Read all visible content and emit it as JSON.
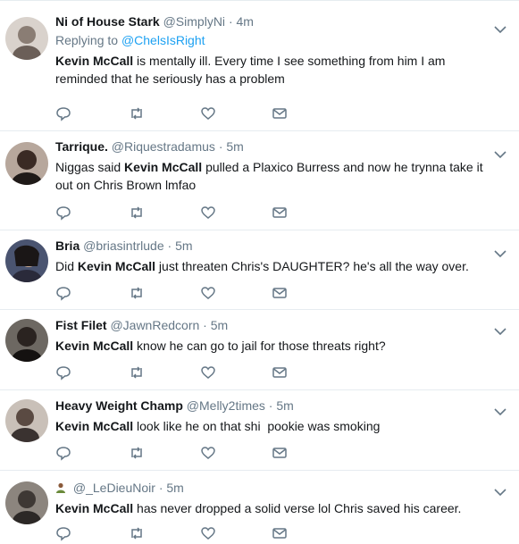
{
  "tweets": [
    {
      "name": "Ni of House Stark",
      "handle": "@SimplyNi",
      "time": "4m",
      "reply_prefix": "Replying to",
      "reply_handle": "@ChelsIsRight",
      "bold": "Kevin McCall",
      "text": " is mentally ill. Every time I see something from him I am reminded that he seriously has a problem",
      "avatar_color": "#8a7d74"
    },
    {
      "name": "Tarrique.",
      "handle": "@Riquestradamus",
      "time": "5m",
      "pre": "Niggas said ",
      "bold": "Kevin McCall",
      "text": " pulled a Plaxico Burress and now he trynna take it out on Chris Brown lmfao",
      "avatar_color": "#3a2a24"
    },
    {
      "name": "Bria",
      "handle": "@briasintrlude",
      "time": "5m",
      "pre": "Did ",
      "bold": "Kevin McCall",
      "text": " just threaten Chris's DAUGHTER? he's all the way over.",
      "avatar_color": "#5a6a8a"
    },
    {
      "name": "Fist Filet",
      "handle": "@JawnRedcorn",
      "time": "5m",
      "bold": "Kevin McCall",
      "text": " know he can go to jail for those threats right?",
      "avatar_color": "#2a2320"
    },
    {
      "name": "Heavy Weight Champ",
      "handle": "@Melly2times",
      "time": "5m",
      "bold": "Kevin McCall",
      "text": " look like he on that shi  pookie was smoking",
      "avatar_color": "#6a5a52"
    },
    {
      "name": "",
      "handle": "@_LeDieuNoir",
      "time": "5m",
      "emoji_name": "person-emoji",
      "bold": "Kevin McCall",
      "text": " has never dropped a solid verse lol Chris saved his career.",
      "avatar_color": "#4a4540"
    }
  ],
  "separator": "·",
  "colors": {
    "accent": "#1da1f2",
    "muted": "#657786",
    "text": "#14171a",
    "border": "#e6ecf0"
  },
  "icons": [
    "reply-icon",
    "retweet-icon",
    "like-icon",
    "direct-message-icon",
    "caret-down-icon"
  ]
}
